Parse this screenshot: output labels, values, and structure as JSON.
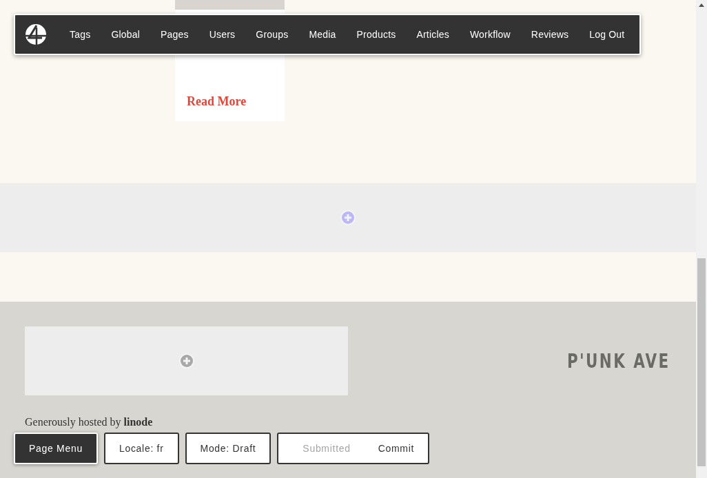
{
  "nav": {
    "items": [
      {
        "label": "Tags"
      },
      {
        "label": "Global"
      },
      {
        "label": "Pages"
      },
      {
        "label": "Users"
      },
      {
        "label": "Groups"
      },
      {
        "label": "Media"
      },
      {
        "label": "Products"
      },
      {
        "label": "Articles"
      },
      {
        "label": "Workflow"
      },
      {
        "label": "Reviews"
      },
      {
        "label": "Log Out"
      }
    ]
  },
  "card": {
    "link": "Read More"
  },
  "footer": {
    "logo": "P'UNK AVE",
    "credit": "Generously hosted by **linode**"
  },
  "admin_bar": [
    {
      "kind": "menu",
      "label": "Page Menu"
    },
    {
      "kind": "plain",
      "label": "Locale: fr"
    },
    {
      "kind": "plain",
      "label": "Mode: Draft"
    },
    {
      "kind": "group",
      "actions": [
        {
          "label": "Submitted",
          "disabled": true
        },
        {
          "label": "Commit",
          "disabled": false
        }
      ]
    }
  ]
}
